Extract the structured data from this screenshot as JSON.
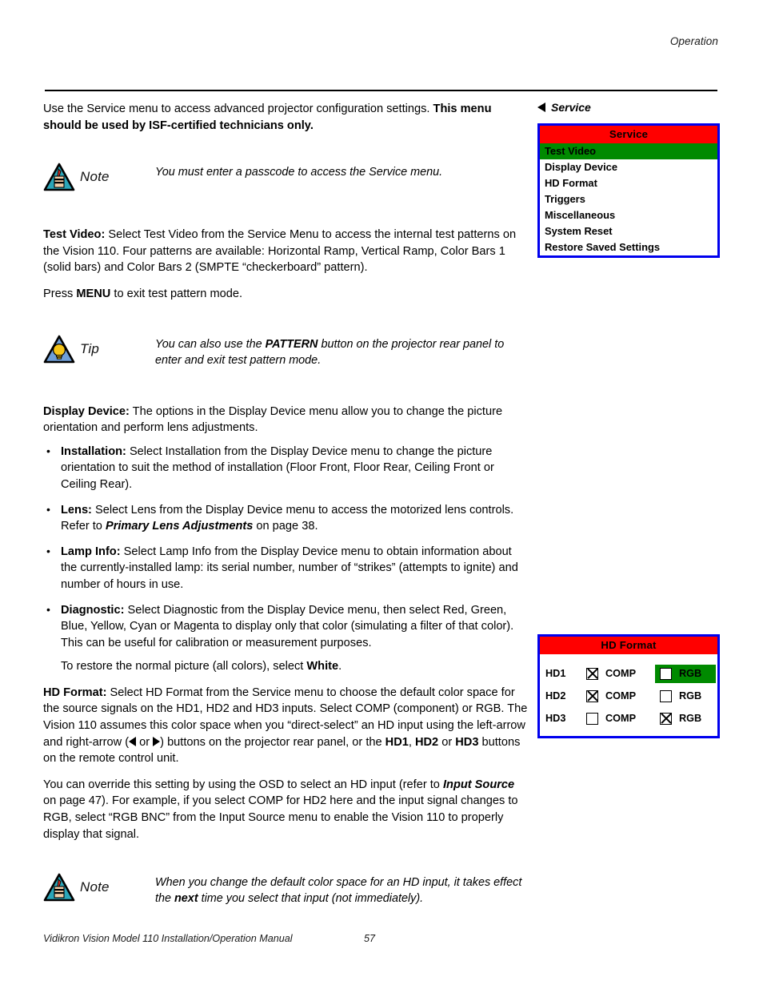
{
  "header": {
    "running_head": "Operation"
  },
  "footer": {
    "manual_title": "Vidikron Vision Model 110 Installation/Operation Manual",
    "page_number": "57"
  },
  "colors": {
    "osd_border": "#0000EE",
    "osd_title_bg": "#FF0000",
    "osd_highlight": "#008A00",
    "note_triangle": "#2BA6B8",
    "tip_triangle": "#6F9FD8",
    "bulb": "#F5C518"
  },
  "intro": {
    "text_plain_1": "Use the Service menu to access advanced projector configuration settings. ",
    "text_bold_1": "This menu should be used by ISF-certified technicians only."
  },
  "note_1": {
    "word": "Note",
    "icon": "note-triangle-icon",
    "text": "You must enter a passcode to access the Service menu."
  },
  "test_video": {
    "lead": "Test Video:",
    "body": " Select Test Video from the Service Menu to access the internal test patterns on the Vision 110. Four patterns are available: Horizontal Ramp, Vertical Ramp, Color Bars 1 (solid bars) and Color Bars 2 (SMPTE “checkerboard” pattern).",
    "menu_line_pre": "Press ",
    "menu_line_bold": "MENU",
    "menu_line_post": " to exit test pattern mode."
  },
  "tip_1": {
    "word": "Tip",
    "icon": "tip-triangle-icon",
    "text_pre": "You can also use the ",
    "text_bold": "PATTERN",
    "text_post": " button on the projector rear panel to enter and exit test pattern mode."
  },
  "display_device": {
    "lead": "Display Device:",
    "body": " The options in the Display Device menu allow you to change the picture orientation and perform lens adjustments.",
    "bullets": [
      {
        "lead": "Installation:",
        "body": " Select Installation from the Display Device menu to change the picture orientation to suit the method of installation (Floor Front, Floor Rear, Ceiling Front or Ceiling Rear)."
      },
      {
        "lead": "Lens:",
        "body": " Select Lens from the Display Device menu to access the motorized lens controls. Refer to ",
        "ref": "Primary Lens Adjustments",
        "body_end": " on page 38."
      },
      {
        "lead": "Lamp Info:",
        "body": " Select Lamp Info from the Display Device menu to obtain information about the currently-installed lamp: its serial number, number of “strikes” (attempts to ignite) and number of hours in use."
      },
      {
        "lead": "Diagnostic:",
        "body": " Select Diagnostic from the Display Device menu, then select Red, Green, Blue, Yellow, Cyan or Magenta to display only that color (simulating a filter of that color). This can be useful for calibration or measurement purposes."
      }
    ],
    "restore_pre": "To restore the normal picture (all colors), select ",
    "restore_bold": "White",
    "restore_post": "."
  },
  "hd_format_text": {
    "lead": "HD Format:",
    "p1_a": " Select HD Format from the Service menu to choose the default color space for the source signals on the HD1, HD2 and HD3 inputs. Select COMP (component) or RGB. The Vision 110 assumes this color space when you “direct-select” an HD input using the left-arrow and right-arrow (",
    "p1_or": " or ",
    "p1_b": ") buttons on the projector rear panel, or the ",
    "p1_hd1": "HD1",
    "p1_comma": ", ",
    "p1_hd2": "HD2",
    "p1_c": " or ",
    "p1_hd3": "HD3",
    "p1_d": " buttons on the remote control unit.",
    "p2_a": "You can override this setting by using the OSD to select an HD input (refer to ",
    "p2_ref": "Input Source",
    "p2_b": " on page 47). For example, if you select COMP for HD2 here and the input signal changes to RGB, select “RGB BNC” from the Input Source menu to enable the Vision 110 to properly display that signal."
  },
  "note_2": {
    "word": "Note",
    "icon": "note-triangle-icon",
    "text_pre": "When you change the default color space for an HD input, it takes effect the ",
    "text_bold": "next",
    "text_post": " time you select that input (not immediately)."
  },
  "service_menu": {
    "breadcrumb": "Service",
    "title": "Service",
    "items": [
      {
        "label": "Test Video",
        "selected": true
      },
      {
        "label": "Display Device",
        "selected": false
      },
      {
        "label": "HD Format",
        "selected": false
      },
      {
        "label": "Triggers",
        "selected": false
      },
      {
        "label": "Miscellaneous",
        "selected": false
      },
      {
        "label": "System Reset",
        "selected": false
      },
      {
        "label": "Restore Saved Settings",
        "selected": false
      }
    ]
  },
  "hd_format_menu": {
    "title": "HD Format",
    "col_comp": "COMP",
    "col_rgb": "RGB",
    "rows": [
      {
        "name": "HD1",
        "comp_checked": true,
        "rgb_checked": false,
        "highlight": "rgb"
      },
      {
        "name": "HD2",
        "comp_checked": true,
        "rgb_checked": false,
        "highlight": "none"
      },
      {
        "name": "HD3",
        "comp_checked": false,
        "rgb_checked": true,
        "highlight": "none"
      }
    ]
  }
}
